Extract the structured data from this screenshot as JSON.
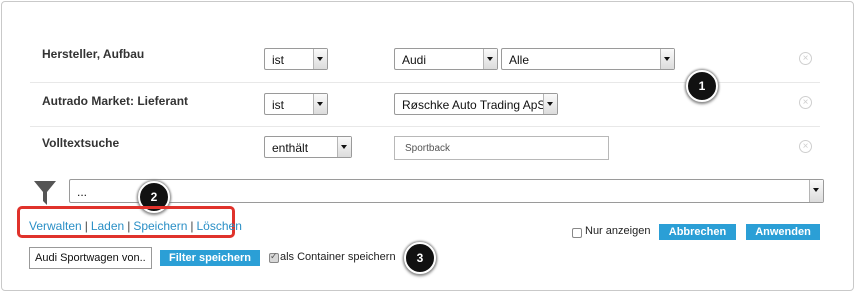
{
  "filters": [
    {
      "label": "Hersteller, Aufbau",
      "operator": "ist",
      "values": [
        "Audi",
        "Alle"
      ]
    },
    {
      "label": "Autrado Market: Lieferant",
      "operator": "ist",
      "values": [
        "Røschke Auto Trading ApS"
      ]
    },
    {
      "label": "Volltextsuche",
      "operator": "enthält",
      "text_value": "Sportback"
    }
  ],
  "saved_filter_select": {
    "value": "..."
  },
  "links": {
    "manage": "Verwalten",
    "load": "Laden",
    "save": "Speichern",
    "delete": "Löschen",
    "separator": "|"
  },
  "only_show": {
    "label": "Nur anzeigen",
    "checked": false
  },
  "buttons": {
    "cancel": "Abbrechen",
    "apply": "Anwenden",
    "save_filter": "Filter speichern"
  },
  "filter_name_input": {
    "value": "Audi Sportwagen von.."
  },
  "container_save": {
    "label": "als Container speichern",
    "checked": true
  },
  "callouts": [
    "1",
    "2",
    "3"
  ],
  "icons": {
    "remove": "remove-circle-icon",
    "funnel": "funnel-icon",
    "dropdown": "dropdown-arrow-icon"
  },
  "colors": {
    "link": "#2a8fc6",
    "button": "#2b9fd6",
    "highlight": "#e0322b",
    "callout": "#111111"
  }
}
